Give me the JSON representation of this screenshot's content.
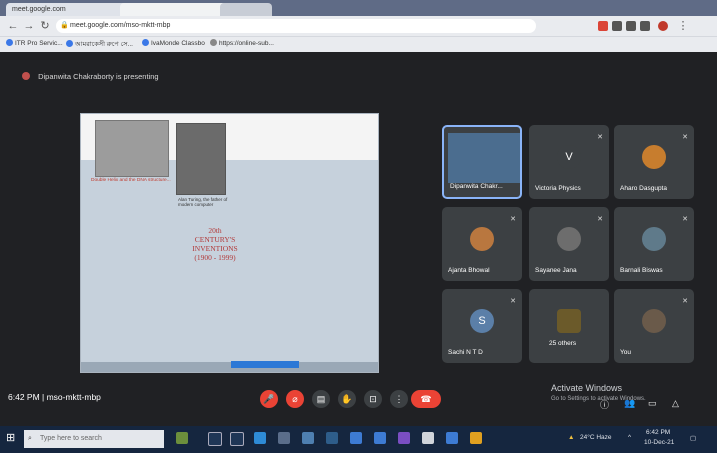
{
  "browser": {
    "tabs": [
      "meet.google.com",
      "",
      ""
    ],
    "address": "meet.google.com/mso-mktt-mbp",
    "bookmarks": [
      "ITR Pro Servic...",
      "আমরাকেসী রুপে সে...",
      "IvaMonde Classbo",
      "https://online-sub..."
    ]
  },
  "meet": {
    "presenting_text": "Dipanwita Chakraborty is presenting",
    "slide": {
      "red_text": "Double Helix and the DNA structure...",
      "caption": "Alan Turing, the father of modern computer",
      "title_lines": [
        "20th",
        "CENTURY'S",
        "INVENTIONS",
        "(1900 - 1999)"
      ]
    },
    "participants": [
      {
        "name": "Dipanwita Chakr...",
        "avatar": "",
        "type": "video",
        "active": true
      },
      {
        "name": "Victoria Physics",
        "avatar": "V",
        "type": "letter",
        "color": "#3c4043"
      },
      {
        "name": "Aharo Dasgupta",
        "avatar": "",
        "type": "photo",
        "color": "#c77d2e"
      },
      {
        "name": "Ajanta Bhowal",
        "avatar": "",
        "type": "photo",
        "color": "#b9773f"
      },
      {
        "name": "Sayanee Jana",
        "avatar": "",
        "type": "photo",
        "color": "#6d6d6d"
      },
      {
        "name": "Barnali Biswas",
        "avatar": "",
        "type": "photo",
        "color": "#5f7a8a"
      },
      {
        "name": "Sachi N T D",
        "avatar": "S",
        "type": "letter",
        "color": "#5b7fa8"
      },
      {
        "name": "25 others",
        "avatar": "",
        "type": "others",
        "color": "#3c4043"
      },
      {
        "name": "You",
        "avatar": "",
        "type": "photo",
        "color": "#6a5a4a"
      }
    ],
    "time_code": "6:42 PM | mso-mktt-mbp",
    "activate_title": "Activate Windows",
    "activate_sub": "Go to Settings to activate Windows."
  },
  "taskbar": {
    "search_placeholder": "Type here to search",
    "weather": "24°C Haze",
    "clock_time": "6:42 PM",
    "clock_date": "10-Dec-21"
  }
}
